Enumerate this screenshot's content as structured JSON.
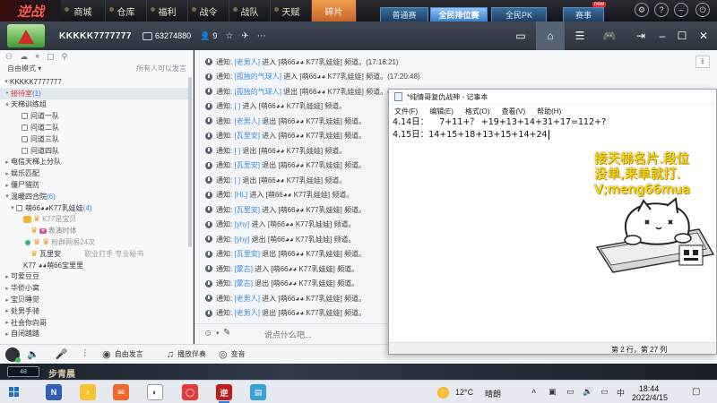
{
  "game_bar": {
    "logo": "逆战",
    "menus": [
      "商城",
      "仓库",
      "福利",
      "战令",
      "战队",
      "天赋",
      "碎片"
    ],
    "tabs": [
      "普通赛",
      "全民排位赛",
      "全民PK",
      "赛事"
    ],
    "tab_badge": "new",
    "active_menu": "碎片",
    "active_tab": "全民排位赛"
  },
  "yy_header": {
    "channel_name": "KKKKK7777777",
    "channel_id": "63274880",
    "member_count": "9",
    "icons": [
      "star-icon",
      "airplane-icon",
      "more-icon"
    ],
    "right_icons": [
      "video-icon",
      "home-icon",
      "list-icon",
      "gamepad-icon",
      "exit-icon",
      "minimize-icon",
      "maximize-icon",
      "close-icon"
    ]
  },
  "left_panel": {
    "mode": "自由模式",
    "mode_hint": "所有人可以发言",
    "tree": [
      {
        "label": "KKKKK7777777",
        "depth": 0
      },
      {
        "label": "接待室",
        "count": "(1)",
        "depth": 0,
        "red": true
      },
      {
        "label": "天梯训练组",
        "depth": 0
      },
      {
        "label": "问道一队",
        "depth": 1
      },
      {
        "label": "问道二队",
        "depth": 1
      },
      {
        "label": "问道三队",
        "depth": 1
      },
      {
        "label": "问道四队",
        "depth": 1
      },
      {
        "label": "电信天梯上分队",
        "depth": 0
      },
      {
        "label": "娱乐匹配",
        "depth": 0
      },
      {
        "label": "僵尸猎防",
        "depth": 0
      },
      {
        "label": "温暖四合院",
        "count": "(6)",
        "depth": 0
      },
      {
        "label": "萌66◕◕K77乳娃娃",
        "count": "(4)",
        "depth": 1
      },
      {
        "label": "K77是宝贝",
        "depth": 2
      },
      {
        "label": "表演时体",
        "depth": 2
      },
      {
        "label": "粉群网易24次",
        "depth": 2
      },
      {
        "label": "瓦里安",
        "extra": "职业打手  专业秘书",
        "depth": 2
      },
      {
        "label": "K77 ◕◕萌66宝里里",
        "depth": 1
      },
      {
        "label": "可爱豆豆",
        "depth": 0
      },
      {
        "label": "华侨小窝",
        "depth": 0
      },
      {
        "label": "宝贝睡觉",
        "depth": 0
      },
      {
        "label": "处男手骑",
        "depth": 0
      },
      {
        "label": "社会你向哥",
        "depth": 0
      },
      {
        "label": "自闭踏踏",
        "depth": 0
      }
    ]
  },
  "chat": {
    "prefix": "通知:",
    "lines": [
      {
        "user": "[老男人]",
        "action": "进入",
        "room": "[萌66◕◕ K77乳娃娃]",
        "tail": "频道。(17:18:21)"
      },
      {
        "user": "[孤独的气球人]",
        "action": "进入",
        "room": "[萌66◕◕ K77乳娃娃]",
        "tail": "频道。(17:20:48)"
      },
      {
        "user": "[孤独的气球人]",
        "action": "退出",
        "room": "[萌66◕◕ K77乳娃娃]",
        "tail": "频道。(17:29:46)"
      },
      {
        "user": "[ ]",
        "action": "进入",
        "room": "[萌66◕◕ K77乳娃娃]",
        "tail": "频道。"
      },
      {
        "user": "[老男人]",
        "action": "退出",
        "room": "[萌66◕◕ K77乳娃娃]",
        "tail": "频道。"
      },
      {
        "user": "[瓦里安]",
        "action": "进入",
        "room": "[萌66◕◕ K77乳娃娃]",
        "tail": "频道。"
      },
      {
        "user": "[ ]",
        "action": "退出",
        "room": "[萌66◕◕ K77乳娃娃]",
        "tail": "频道。"
      },
      {
        "user": "[瓦里安]",
        "action": "退出",
        "room": "[萌66◕◕ K77乳娃娃]",
        "tail": "频道。"
      },
      {
        "user": "[ ]",
        "action": "退出",
        "room": "[萌66◕◕ K77乳娃娃]",
        "tail": "频道。"
      },
      {
        "user": "[HL]",
        "action": "进入",
        "room": "[萌66◕◕ K77乳娃娃]",
        "tail": "频道。"
      },
      {
        "user": "[瓦里安]",
        "action": "进入",
        "room": "[萌66◕◕ K77乳娃娃]",
        "tail": "频道。"
      },
      {
        "user": "[yhy]",
        "action": "进入",
        "room": "[萌66◕◕ K77乳娃娃]",
        "tail": "频道。"
      },
      {
        "user": "[yhy]",
        "action": "退出",
        "room": "[萌66◕◕ K77乳娃娃]",
        "tail": "频道。"
      },
      {
        "user": "[瓦里安]",
        "action": "退出",
        "room": "[萌66◕◕ K77乳娃娃]",
        "tail": "频道。"
      },
      {
        "user": "[蒙古]",
        "action": "进入",
        "room": "[萌66◕◕ K77乳娃娃]",
        "tail": "频道。"
      },
      {
        "user": "[蒙古]",
        "action": "退出",
        "room": "[萌66◕◕ K77乳娃娃]",
        "tail": "频道。"
      },
      {
        "user": "[老男人]",
        "action": "进入",
        "room": "[萌66◕◕ K77乳娃娃]",
        "tail": "频道。"
      },
      {
        "user": "[老男人]",
        "action": "退出",
        "room": "[萌66◕◕ K77乳娃娃]",
        "tail": "频道。"
      }
    ],
    "input_placeholder": "说点什么吧..."
  },
  "bottom_bar": {
    "free_speak": "自由发言",
    "accompany": "播放伴奏",
    "voice_change": "变音"
  },
  "game_strip": {
    "level": "48",
    "player": "步青晨"
  },
  "notepad": {
    "title": "*纯情哥复仇战神 - 记事本",
    "menu": [
      "文件(F)",
      "编辑(E)",
      "格式(O)",
      "查看(V)",
      "帮助(H)"
    ],
    "line1": "4.14日：    7+11+？ +19+13+14+31+17=112+?",
    "line2": "4.15日：14+15+18+13+15+14+24",
    "status": "第 2 行，第 27 列"
  },
  "ad": {
    "line1": "接天梯名片.段位",
    "line2": "没单,来单就打.",
    "line3": "V;meng66mua"
  },
  "taskbar": {
    "temp": "12°C",
    "weather": "晴朗",
    "ime": "中",
    "time": "18:44",
    "date": "2022/4/15"
  }
}
